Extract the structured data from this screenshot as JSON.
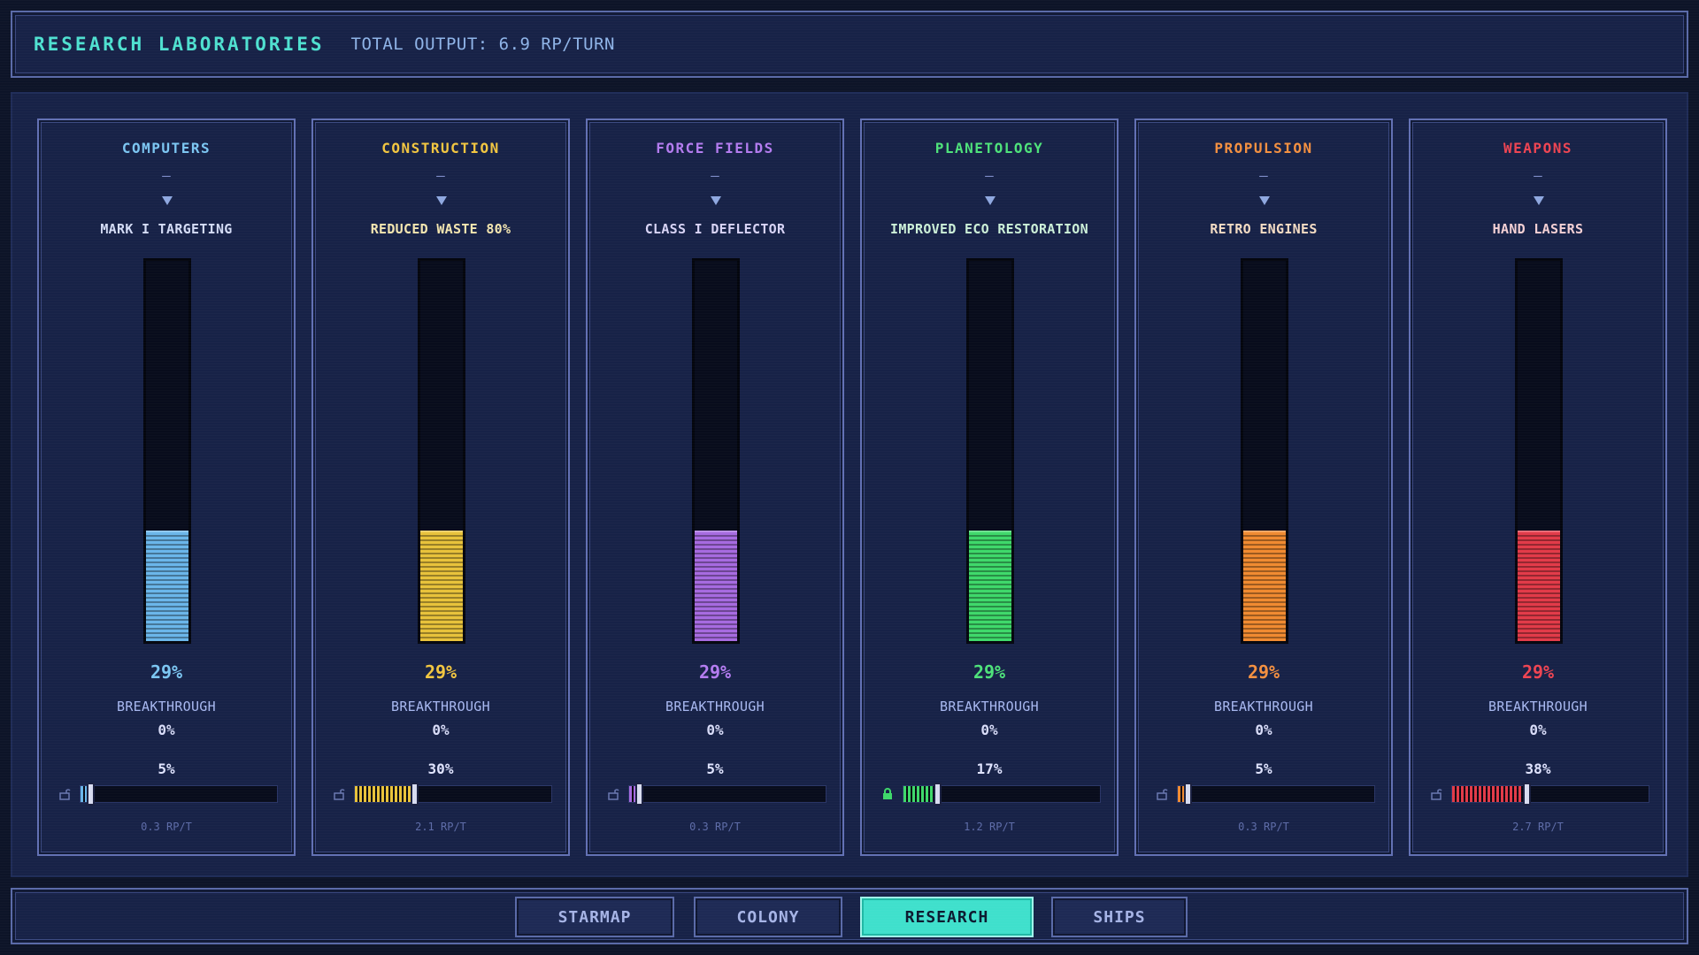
{
  "header": {
    "title": "RESEARCH LABORATORIES",
    "output": "TOTAL OUTPUT: 6.9 RP/TURN"
  },
  "fields": [
    {
      "name": "COMPUTERS",
      "dash": "–",
      "tech": "MARK I TARGETING",
      "progress_pct": 29,
      "progress": "29%",
      "bt_label": "BREAKTHROUGH",
      "bt": "0%",
      "alloc_pct": 5,
      "alloc": "5%",
      "rp": "0.3 RP/T",
      "locked": false,
      "color": "#6ab6ea",
      "title_color": "#7cc6f2",
      "tech_color": "#d4dcf6"
    },
    {
      "name": "CONSTRUCTION",
      "dash": "–",
      "tech": "REDUCED WASTE 80%",
      "progress_pct": 29,
      "progress": "29%",
      "bt_label": "BREAKTHROUGH",
      "bt": "0%",
      "alloc_pct": 30,
      "alloc": "30%",
      "rp": "2.1 RP/T",
      "locked": false,
      "color": "#e8c23a",
      "title_color": "#f2c640",
      "tech_color": "#f4e6b0"
    },
    {
      "name": "FORCE FIELDS",
      "dash": "–",
      "tech": "CLASS I DEFLECTOR",
      "progress_pct": 29,
      "progress": "29%",
      "bt_label": "BREAKTHROUGH",
      "bt": "0%",
      "alloc_pct": 5,
      "alloc": "5%",
      "rp": "0.3 RP/T",
      "locked": false,
      "color": "#a66ae0",
      "title_color": "#b47cf0",
      "tech_color": "#d8d4f6"
    },
    {
      "name": "PLANETOLOGY",
      "dash": "–",
      "tech": "IMPROVED ECO RESTORATION",
      "progress_pct": 29,
      "progress": "29%",
      "bt_label": "BREAKTHROUGH",
      "bt": "0%",
      "alloc_pct": 17,
      "alloc": "17%",
      "rp": "1.2 RP/T",
      "locked": true,
      "color": "#3ed86a",
      "title_color": "#4ee27a",
      "tech_color": "#ccf0d8"
    },
    {
      "name": "PROPULSION",
      "dash": "–",
      "tech": "RETRO ENGINES",
      "progress_pct": 29,
      "progress": "29%",
      "bt_label": "BREAKTHROUGH",
      "bt": "0%",
      "alloc_pct": 5,
      "alloc": "5%",
      "rp": "0.3 RP/T",
      "locked": false,
      "color": "#f08a30",
      "title_color": "#f49040",
      "tech_color": "#f4dcc4"
    },
    {
      "name": "WEAPONS",
      "dash": "–",
      "tech": "HAND LASERS",
      "progress_pct": 29,
      "progress": "29%",
      "bt_label": "BREAKTHROUGH",
      "bt": "0%",
      "alloc_pct": 38,
      "alloc": "38%",
      "rp": "2.7 RP/T",
      "locked": false,
      "color": "#e23a48",
      "title_color": "#ee4452",
      "tech_color": "#f4d0d4"
    }
  ],
  "nav": [
    {
      "label": "STARMAP",
      "active": false
    },
    {
      "label": "COLONY",
      "active": false
    },
    {
      "label": "RESEARCH",
      "active": true
    },
    {
      "label": "SHIPS",
      "active": false
    }
  ]
}
